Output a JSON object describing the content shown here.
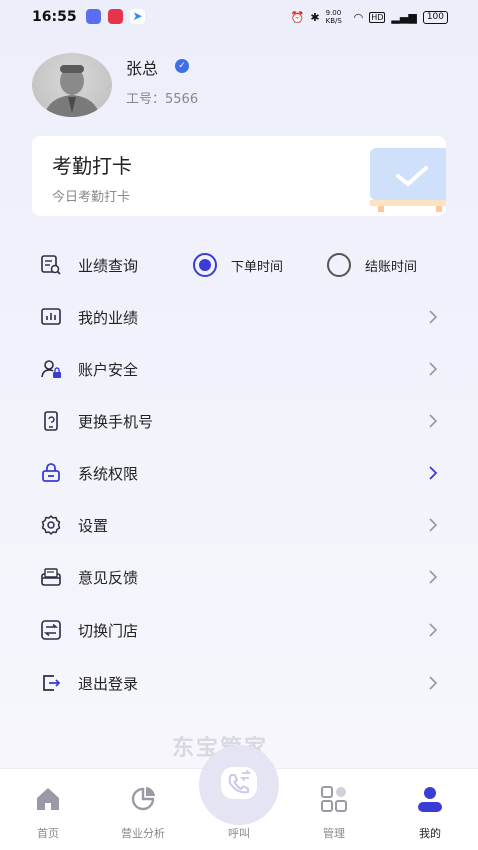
{
  "status_bar": {
    "time": "16:55",
    "right_text": "9.00 KB/S",
    "battery": "100"
  },
  "profile": {
    "name": "张总",
    "employee_id": "工号：5566"
  },
  "attendance_card": {
    "title": "考勤打卡",
    "subtitle": "今日考勤打卡"
  },
  "performance_query": {
    "label": "业绩查询",
    "options": [
      {
        "label": "下单时间",
        "selected": true
      },
      {
        "label": "结账时间",
        "selected": false
      }
    ]
  },
  "menu": [
    {
      "label": "我的业绩",
      "icon": "chart-icon"
    },
    {
      "label": "账户安全",
      "icon": "user-lock-icon"
    },
    {
      "label": "更换手机号",
      "icon": "phone-icon"
    },
    {
      "label": "系统权限",
      "icon": "lock-icon"
    },
    {
      "label": "设置",
      "icon": "gear-icon"
    },
    {
      "label": "意见反馈",
      "icon": "feedback-icon"
    },
    {
      "label": "切换门店",
      "icon": "switch-icon"
    },
    {
      "label": "退出登录",
      "icon": "logout-icon"
    }
  ],
  "watermark": "东宝管家",
  "tabbar": {
    "tabs": [
      {
        "label": "首页",
        "icon": "home-icon"
      },
      {
        "label": "营业分析",
        "icon": "pie-chart-icon"
      },
      {
        "label": "呼叫",
        "icon": "phone-call-icon"
      },
      {
        "label": "管理",
        "icon": "grid-icon"
      },
      {
        "label": "我的",
        "icon": "person-icon"
      }
    ],
    "active_index": 4
  },
  "colors": {
    "accent": "#3b3bd6",
    "icon_dark": "#2c2c44"
  }
}
